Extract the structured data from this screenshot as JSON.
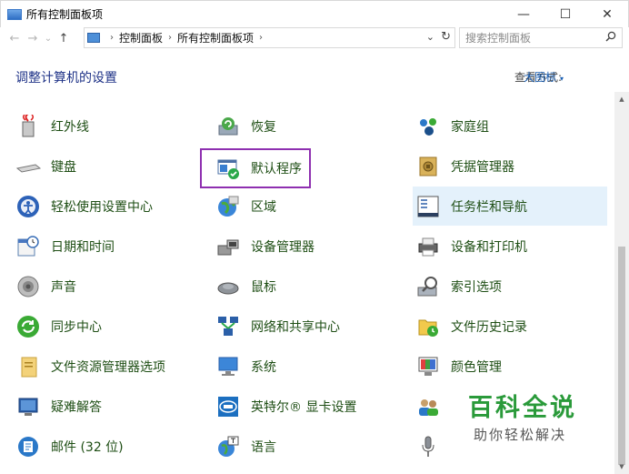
{
  "window": {
    "title": "所有控制面板项",
    "min_glyph": "—",
    "max_glyph": "☐",
    "close_glyph": "✕"
  },
  "nav": {
    "back_glyph": "←",
    "forward_glyph": "→",
    "history_glyph": "⌄",
    "up_glyph": "↑"
  },
  "address": {
    "crumbs": [
      "控制面板",
      "所有控制面板项"
    ],
    "separator": "›",
    "dropdown_glyph": "⌄",
    "refresh_glyph": "↻"
  },
  "search": {
    "placeholder": "搜索控制面板"
  },
  "header": {
    "heading": "调整计算机的设置",
    "view_by_label": "查看方式:",
    "view_by_value": "大图标",
    "view_by_caret": "▾"
  },
  "items": {
    "col1": [
      {
        "label": "红外线",
        "icon": "infrared-icon"
      },
      {
        "label": "键盘",
        "icon": "keyboard-icon"
      },
      {
        "label": "轻松使用设置中心",
        "icon": "ease-of-access-icon"
      },
      {
        "label": "日期和时间",
        "icon": "date-time-icon"
      },
      {
        "label": "声音",
        "icon": "sound-icon"
      },
      {
        "label": "同步中心",
        "icon": "sync-center-icon"
      },
      {
        "label": "文件资源管理器选项",
        "icon": "folder-options-icon"
      },
      {
        "label": "疑难解答",
        "icon": "troubleshooting-icon"
      },
      {
        "label": "邮件 (32 位)",
        "icon": "mail-icon"
      }
    ],
    "col2": [
      {
        "label": "恢复",
        "icon": "recovery-icon"
      },
      {
        "label": "默认程序",
        "icon": "default-programs-icon"
      },
      {
        "label": "区域",
        "icon": "region-icon"
      },
      {
        "label": "设备管理器",
        "icon": "device-manager-icon"
      },
      {
        "label": "鼠标",
        "icon": "mouse-icon"
      },
      {
        "label": "网络和共享中心",
        "icon": "network-sharing-icon"
      },
      {
        "label": "系统",
        "icon": "system-icon"
      },
      {
        "label": "英特尔® 显卡设置",
        "icon": "intel-graphics-icon"
      },
      {
        "label": "语言",
        "icon": "language-icon"
      }
    ],
    "col3": [
      {
        "label": "家庭组",
        "icon": "homegroup-icon"
      },
      {
        "label": "凭据管理器",
        "icon": "credential-manager-icon"
      },
      {
        "label": "任务栏和导航",
        "icon": "taskbar-navigation-icon"
      },
      {
        "label": "设备和打印机",
        "icon": "devices-printers-icon"
      },
      {
        "label": "索引选项",
        "icon": "indexing-options-icon"
      },
      {
        "label": "文件历史记录",
        "icon": "file-history-icon"
      },
      {
        "label": "颜色管理",
        "icon": "color-management-icon"
      },
      {
        "label": "",
        "icon": "user-accounts-icon"
      },
      {
        "label": "",
        "icon": "speech-recognition-icon"
      }
    ]
  },
  "selected_item": "任务栏和导航",
  "highlighted_item": "默认程序",
  "colors": {
    "heading": "#1e3287",
    "item_text": "#1e4e14",
    "selection_bg": "#e4f1fb",
    "highlight_box": "#8e2fb0",
    "watermark_green": "#2a9a3a"
  },
  "watermark": {
    "main": "百科全说",
    "sub": "助你轻松解决"
  }
}
